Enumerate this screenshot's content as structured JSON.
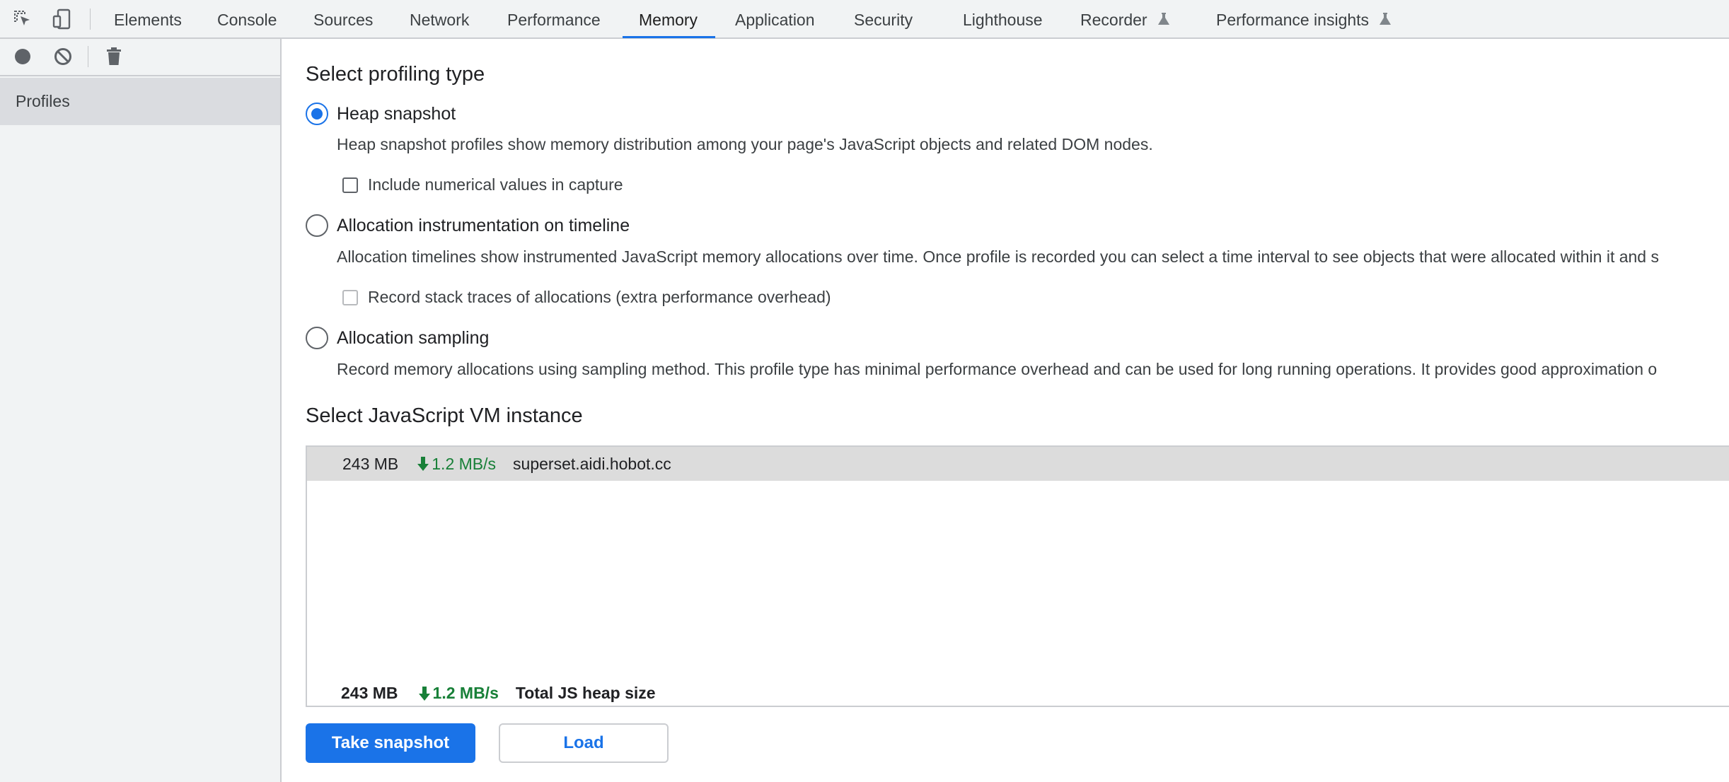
{
  "topbar": {
    "tabs": [
      {
        "label": "Elements"
      },
      {
        "label": "Console"
      },
      {
        "label": "Sources"
      },
      {
        "label": "Network"
      },
      {
        "label": "Performance"
      },
      {
        "label": "Memory",
        "active": true
      },
      {
        "label": "Application"
      },
      {
        "label": "Security"
      },
      {
        "label": "Lighthouse"
      },
      {
        "label": "Recorder",
        "experimental": true
      },
      {
        "label": "Performance insights",
        "experimental": true
      }
    ]
  },
  "sidebar": {
    "profiles_label": "Profiles"
  },
  "main": {
    "profiling_heading": "Select profiling type",
    "options": {
      "heap": {
        "label": "Heap snapshot",
        "selected": true,
        "description": "Heap snapshot profiles show memory distribution among your page's JavaScript objects and related DOM nodes.",
        "checkbox_label": "Include numerical values in capture"
      },
      "timeline": {
        "label": "Allocation instrumentation on timeline",
        "selected": false,
        "description": "Allocation timelines show instrumented JavaScript memory allocations over time. Once profile is recorded you can select a time interval to see objects that were allocated within it and s",
        "checkbox_label": "Record stack traces of allocations (extra performance overhead)"
      },
      "sampling": {
        "label": "Allocation sampling",
        "selected": false,
        "description": "Record memory allocations using sampling method. This profile type has minimal performance overhead and can be used for long running operations. It provides good approximation o"
      }
    },
    "vm_heading": "Select JavaScript VM instance",
    "vm_instance": {
      "size": "243 MB",
      "rate": "1.2 MB/s",
      "host": "superset.aidi.hobot.cc"
    },
    "total": {
      "size": "243 MB",
      "rate": "1.2 MB/s",
      "label": "Total JS heap size"
    },
    "buttons": {
      "take_snapshot": "Take snapshot",
      "load": "Load"
    }
  },
  "colors": {
    "accent": "#1a73e8",
    "rate_green": "#188038"
  }
}
